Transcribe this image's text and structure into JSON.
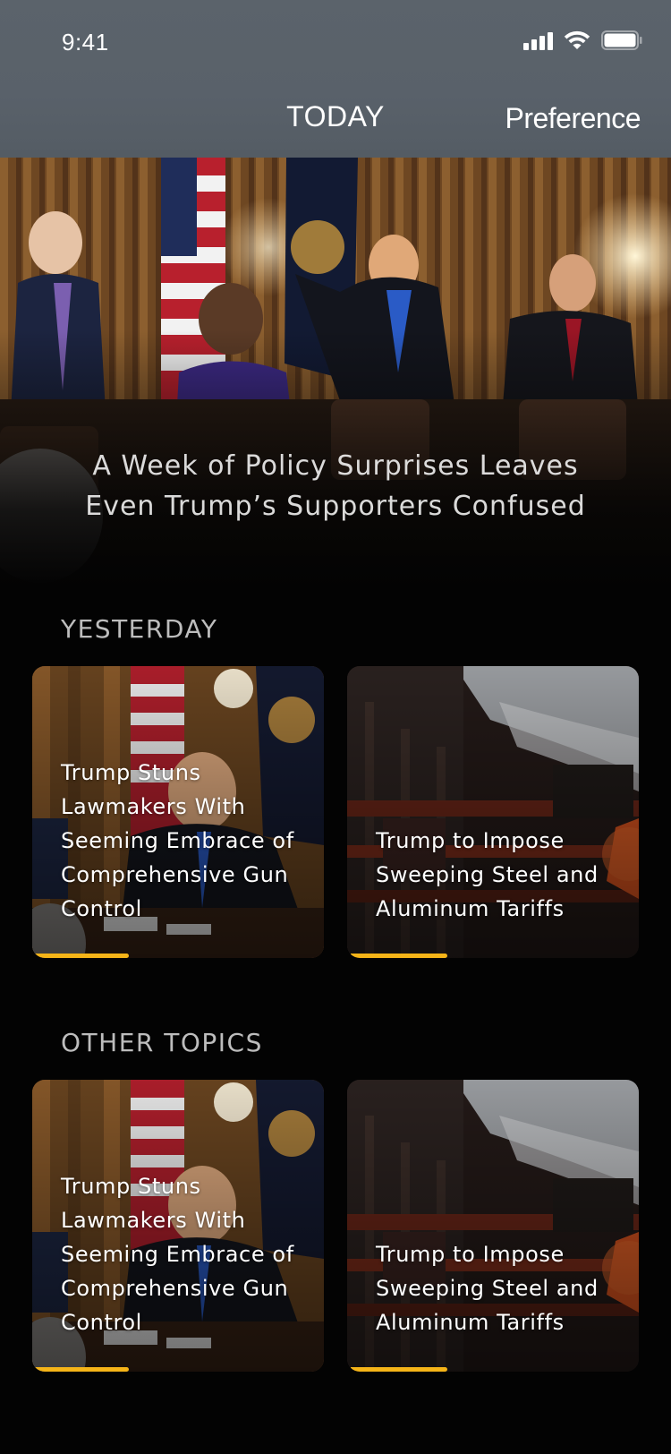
{
  "status_bar": {
    "time": "9:41"
  },
  "nav": {
    "title": "TODAY",
    "preference": "Preference"
  },
  "hero": {
    "title_line1": "A Week of Policy Surprises Leaves",
    "title_line2": "Even Trump’s Supporters Confused"
  },
  "sections": [
    {
      "title": "YESTERDAY",
      "cards": [
        {
          "title": "Trump Stuns Lawmakers With Seeming Embrace of Comprehensive Gun Control",
          "progress": 0.33,
          "image": "cabinet-room"
        },
        {
          "title": "Trump to Impose Sweeping Steel and Aluminum Tariffs",
          "progress": 0.33,
          "image": "steel-mill"
        }
      ]
    },
    {
      "title": "OTHER TOPICS",
      "cards": [
        {
          "title": "Trump Stuns Lawmakers With Seeming Embrace of Comprehensive Gun Control",
          "progress": 0.33,
          "image": "cabinet-room"
        },
        {
          "title": "Trump to Impose Sweeping Steel and Aluminum Tariffs",
          "progress": 0.33,
          "image": "steel-mill"
        }
      ]
    }
  ],
  "colors": {
    "accent": "#f5b418",
    "nav_bg": "#59616a",
    "background": "#030303"
  }
}
